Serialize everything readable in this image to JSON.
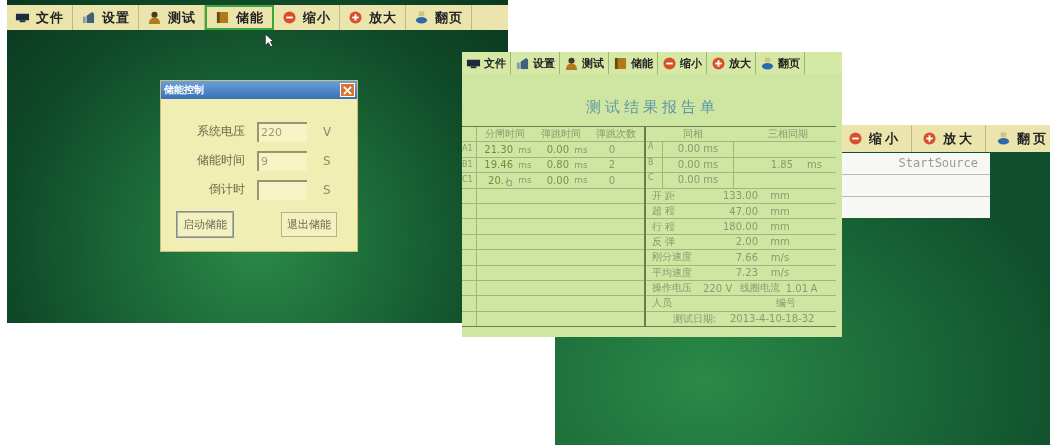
{
  "screens": [
    {
      "toolbar": [
        {
          "label": "文件",
          "kind": "monitor",
          "selected": false
        },
        {
          "label": "设置",
          "kind": "settings",
          "selected": false
        },
        {
          "label": "测试",
          "kind": "person",
          "selected": false
        },
        {
          "label": "储能",
          "kind": "book",
          "selected": true
        },
        {
          "label": "缩小",
          "kind": "minus",
          "selected": false
        },
        {
          "label": "放大",
          "kind": "plus",
          "selected": false
        },
        {
          "label": "翻页",
          "kind": "page",
          "selected": false
        }
      ],
      "dialog": {
        "title": "储能控制",
        "fields": [
          {
            "label": "系统电压",
            "value": "220",
            "unit": "V"
          },
          {
            "label": "储能时间",
            "value": "9",
            "unit": "S"
          },
          {
            "label": "倒计时",
            "unit": "S"
          }
        ],
        "buttons": [
          "启动储能",
          "退出储能"
        ]
      }
    },
    {
      "toolbar": [
        {
          "label": "文件",
          "kind": "monitor",
          "selected": false
        },
        {
          "label": "设置",
          "kind": "settings",
          "selected": false
        },
        {
          "label": "测试",
          "kind": "person",
          "selected": false
        },
        {
          "label": "储能",
          "kind": "book",
          "selected": false
        },
        {
          "label": "缩小",
          "kind": "minus",
          "selected": false
        },
        {
          "label": "放大",
          "kind": "plus",
          "selected": false
        },
        {
          "label": "翻页",
          "kind": "page",
          "selected": false
        }
      ],
      "report": {
        "title": "测试结果报告单",
        "left_columns": [
          "分闸时间",
          "弹跳时间",
          "弹跳次数"
        ],
        "left_rows": [
          {
            "phase": "A1",
            "time": "21.30",
            "unit": "ms",
            "bounce": "0.00",
            "bounce_unit": "ms",
            "count": "0"
          },
          {
            "phase": "B1",
            "time": "19.46",
            "unit": "ms",
            "bounce": "0.80",
            "bounce_unit": "ms",
            "count": "2"
          },
          {
            "phase": "C1",
            "time": "20.",
            "unit": "ms",
            "bounce": "0.00",
            "bounce_unit": "ms",
            "count": "0"
          }
        ],
        "right_columns": [
          "同相",
          "三相同期"
        ],
        "phases": [
          {
            "phase": "A",
            "value": "0.00 ms"
          },
          {
            "phase": "B",
            "value": "0.00 ms"
          },
          {
            "phase": "C",
            "value": "0.00 ms"
          }
        ],
        "sync": {
          "value": "1.85",
          "unit": "ms"
        },
        "measures": [
          {
            "label": "开 距",
            "value": "133.00",
            "unit": "mm"
          },
          {
            "label": "超 程",
            "value": "47.00",
            "unit": "mm"
          },
          {
            "label": "行 程",
            "value": "180.00",
            "unit": "mm"
          },
          {
            "label": "反 弹",
            "value": "2.00",
            "unit": "mm"
          },
          {
            "label": "刚分速度",
            "value": "7.66",
            "unit": "m/s"
          },
          {
            "label": "平均速度",
            "value": "7.23",
            "unit": "m/s"
          }
        ],
        "voltage": {
          "label": "操作电压",
          "value": "220",
          "unit": "V"
        },
        "current": {
          "label": "线圈电流",
          "value": "1.01",
          "unit": "A"
        },
        "person_label": "人员",
        "number_label": "编号",
        "date_label": "测试日期:",
        "date": "2013-4-10-18-32"
      }
    },
    {
      "toolbar": [
        {
          "label": "缩小",
          "kind": "minus",
          "selected": false
        },
        {
          "label": "放大",
          "kind": "plus",
          "selected": false
        },
        {
          "label": "翻页",
          "kind": "page",
          "selected": false
        }
      ],
      "dropdown": {
        "items": [
          "StartSource"
        ]
      }
    }
  ]
}
